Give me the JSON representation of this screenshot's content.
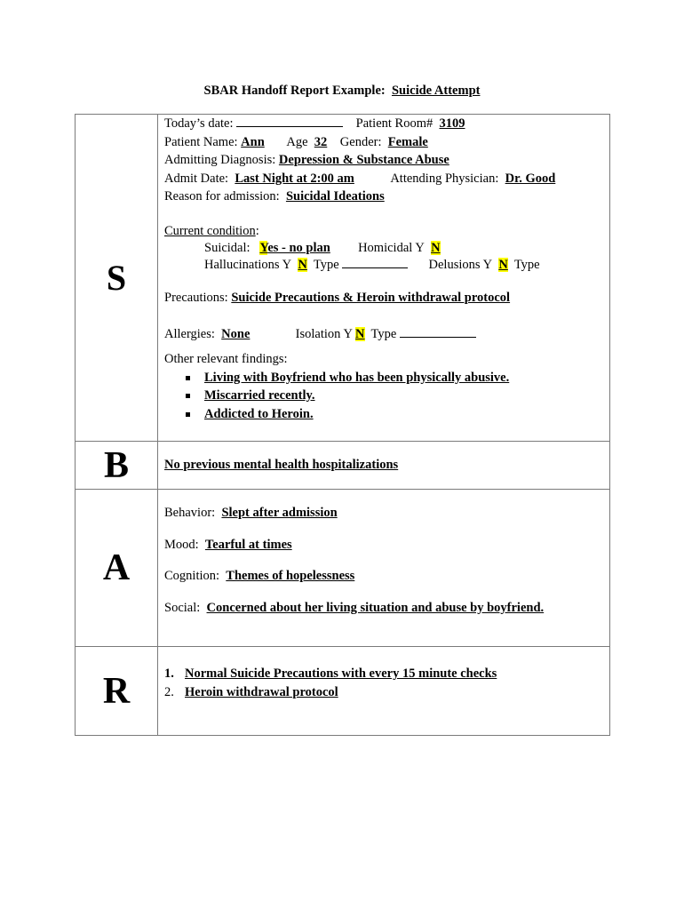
{
  "title": {
    "prefix": "SBAR Handoff Report Example:",
    "subject": "Suicide Attempt"
  },
  "situation": {
    "letter": "S",
    "todays_date_label": "Today’s date:",
    "todays_date_value": "",
    "room_label": "Patient Room#",
    "room_value": "3109",
    "name_label": "Patient Name:",
    "name_value": "Ann",
    "age_label": "Age",
    "age_value": "32",
    "gender_label": "Gender:",
    "gender_value": "Female",
    "diagnosis_label": "Admitting Diagnosis:",
    "diagnosis_value": "Depression & Substance Abuse",
    "admit_date_label": "Admit Date:",
    "admit_date_value": "Last Night at 2:00 am",
    "physician_label": "Attending Physician:",
    "physician_value": "Dr. Good",
    "reason_label": "Reason for admission:",
    "reason_value": "Suicidal Ideations",
    "current_condition_label": "Current condition",
    "suicidal_label": "Suicidal:",
    "suicidal_value_hl": "Y",
    "suicidal_value_rest": "es  - no plan",
    "homicidal_label": "Homicidal Y",
    "homicidal_value": "N",
    "hallucinations_label": "Hallucinations Y",
    "hallucinations_value": "N",
    "type_label": "Type",
    "delusions_label": "Delusions Y",
    "delusions_value": "N",
    "precautions_label": "Precautions:",
    "precautions_value": "Suicide Precautions & Heroin withdrawal protocol",
    "allergies_label": "Allergies:",
    "allergies_value": "None",
    "isolation_label": "Isolation Y",
    "isolation_value": "N",
    "other_findings_label": "Other  relevant findings:",
    "other_findings": [
      "Living with Boyfriend who has been physically abusive.",
      "Miscarried recently.",
      "Addicted to Heroin."
    ]
  },
  "background": {
    "letter": "B",
    "text": "No previous mental health hospitalizations"
  },
  "assessment": {
    "letter": "A",
    "items": [
      {
        "label": "Behavior:",
        "value": "Slept after admission"
      },
      {
        "label": "Mood:",
        "value": "Tearful at times"
      },
      {
        "label": "Cognition:",
        "value": "Themes of hopelessness"
      },
      {
        "label": "Social:",
        "value": "Concerned about her living situation and abuse by boyfriend."
      }
    ]
  },
  "recommendation": {
    "letter": "R",
    "items": [
      {
        "num": "1.",
        "text": "Normal Suicide Precautions with every 15 minute checks"
      },
      {
        "num": "2.",
        "text": "Heroin withdrawal protocol"
      }
    ]
  },
  "colors": {
    "highlight": "#ffff00",
    "border": "#7a7a7a"
  }
}
